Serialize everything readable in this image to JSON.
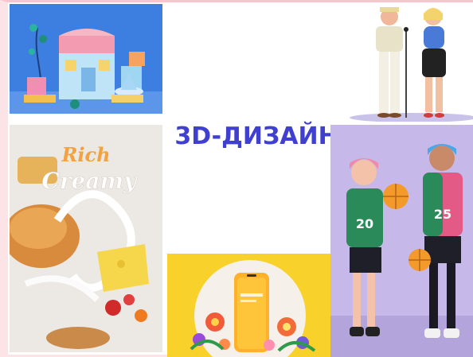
{
  "title": "3D-ДИЗАЙН",
  "tiles": {
    "toy_shop": {
      "icon": "toy-shop-3d-illustration"
    },
    "singers": {
      "icon": "singing-couple-3d-characters"
    },
    "food": {
      "icon": "rich-creamy-food-3d-illustration",
      "lettering": "Rich Creamy"
    },
    "phone": {
      "icon": "smartphone-with-flowers-3d"
    },
    "basketball": {
      "icon": "basketball-players-3d-characters",
      "jersey_left": "20",
      "jersey_right": "25"
    }
  },
  "colors": {
    "title": "#3f3fd0",
    "background": "#ffffff",
    "frame": "#fbe3e6"
  }
}
